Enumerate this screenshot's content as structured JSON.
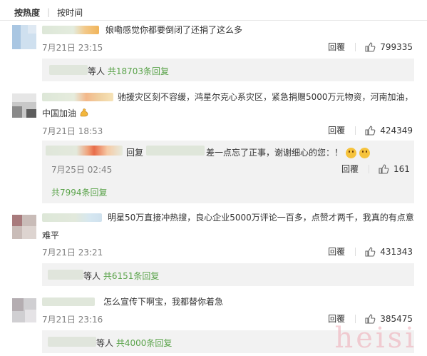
{
  "tabs": {
    "hot": "按热度",
    "time": "按时间"
  },
  "colors": {
    "green": "#5aa34a",
    "meta": "#808080",
    "subbg": "#f2f2f2"
  },
  "comments": [
    {
      "text": "娘嘞感觉你都要倒闭了还捐了这么多",
      "time": "7月21日 23:15",
      "reply": "回覆",
      "likes": "799335",
      "more_prefix": "等人",
      "more_link": "共18703条回复"
    },
    {
      "text1": "驰援灾区刻不容缓，鸿星尔克心系灾区，紧急捐赠5000万元物资，河南加油，",
      "text2": "中国加油",
      "emoji": "flexed-bicep-icon",
      "time": "7月21日 18:53",
      "reply": "回覆",
      "likes": "424349",
      "sub": {
        "prefix": "回复",
        "text": "差一点忘了正事，谢谢细心的您：！",
        "time": "7月25日 02:45",
        "reply": "回覆",
        "likes": "161"
      },
      "more_link": "共7994条回复"
    },
    {
      "text1": "明星50万直接冲热搜，良心企业5000万评论一百多，点赞才两千，我真的有点意",
      "text2": "难平",
      "time": "7月21日 23:21",
      "reply": "回覆",
      "likes": "431343",
      "more_prefix": "等人",
      "more_link": "共6151条回复"
    },
    {
      "text": "怎么宣传下啊宝，我都替你着急",
      "time": "7月21日 23:16",
      "reply": "回覆",
      "likes": "385475",
      "more_prefix": "等人",
      "more_link": "共4000条回复"
    }
  ],
  "watermark": "heisi"
}
